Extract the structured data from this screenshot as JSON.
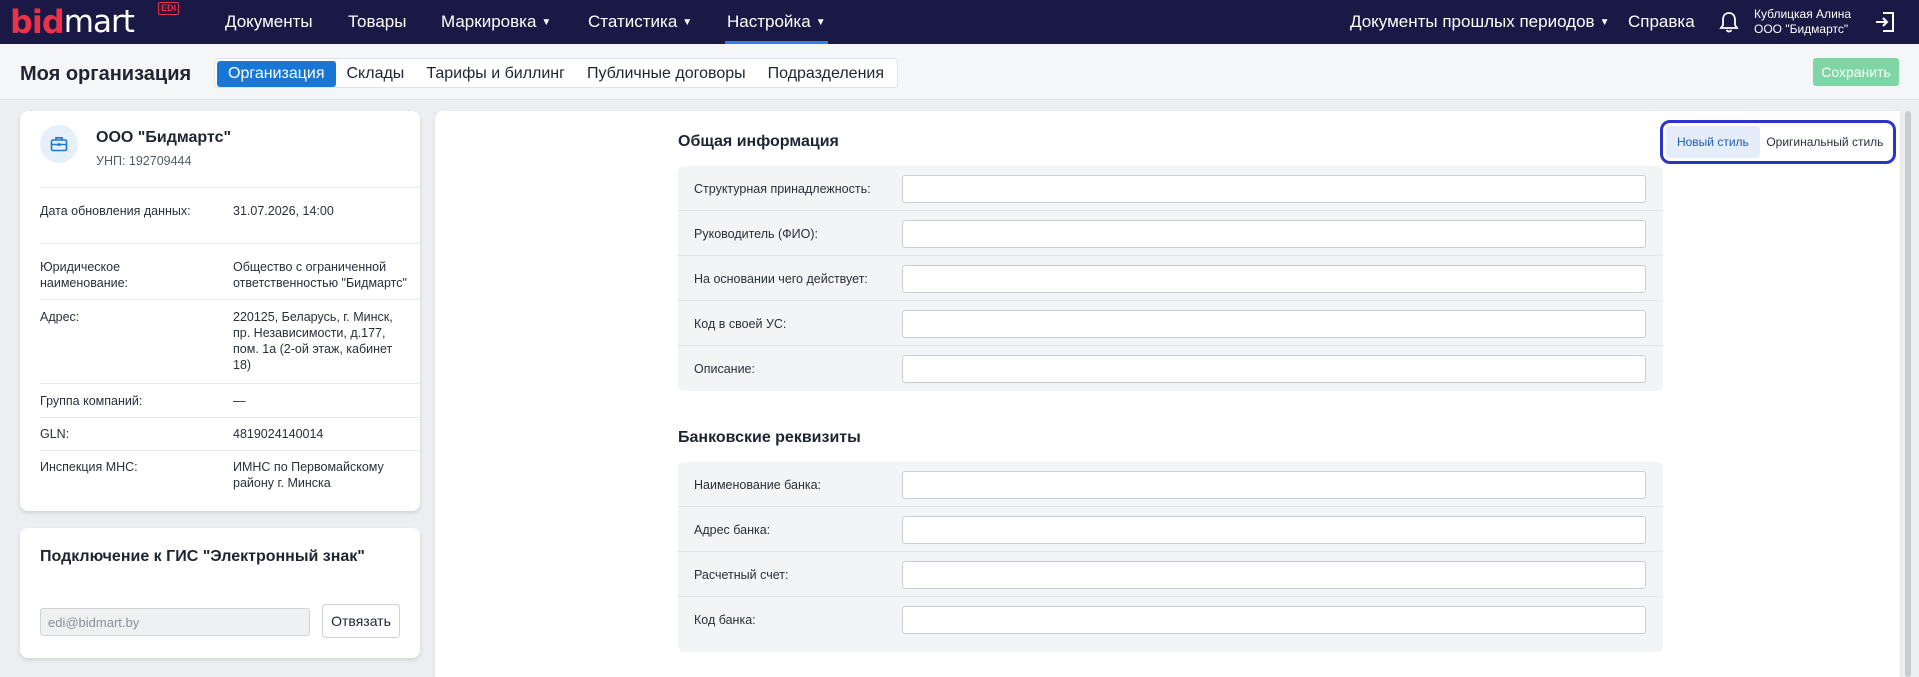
{
  "brand": {
    "bid": "bid",
    "mart": "mart",
    "edi": "EDI"
  },
  "nav": {
    "items": [
      {
        "label": "Документы",
        "chevron": false
      },
      {
        "label": "Товары",
        "chevron": false
      },
      {
        "label": "Маркировка",
        "chevron": true
      },
      {
        "label": "Статистика",
        "chevron": true
      },
      {
        "label": "Настройка",
        "chevron": true
      }
    ],
    "past_docs": "Документы прошлых периодов",
    "help": "Справка",
    "user_name": "Кублицкая Алина",
    "user_org": "ООО \"Бидмартс\""
  },
  "subheader": {
    "title": "Моя организация",
    "tabs": [
      "Организация",
      "Склады",
      "Тарифы и биллинг",
      "Публичные договоры",
      "Подразделения"
    ],
    "save": "Сохранить"
  },
  "org": {
    "name": "ООО \"Бидмартс\"",
    "unp": "УНП: 192709444",
    "rows": [
      {
        "label": "Дата обновления данных:",
        "value": "31.07.2026, 14:00"
      },
      {
        "label": "Юридическое наименование:",
        "value": "Общество с ограниченной ответственностью \"Бидмартс\""
      },
      {
        "label": "Адрес:",
        "value": "220125, Беларусь, г. Минск, пр. Независимости, д.177, пом. 1а (2-ой этаж, кабинет 18)"
      },
      {
        "label": "Группа компаний:",
        "value": "—"
      },
      {
        "label": "GLN:",
        "value": "4819024140014"
      },
      {
        "label": "Инспекция МНС:",
        "value": "ИМНС по Первомайскому району г. Минска"
      }
    ]
  },
  "gis": {
    "title": "Подключение к ГИС \"Электронный знак\"",
    "email_placeholder": "edi@bidmart.by",
    "unlink": "Отвязать"
  },
  "general": {
    "title": "Общая информация",
    "fields": [
      "Структурная принадлежность:",
      "Руководитель (ФИО):",
      "На основании чего действует:",
      "Код в своей УС:",
      "Описание:"
    ]
  },
  "bank": {
    "title": "Банковские реквизиты",
    "fields": [
      "Наименование банка:",
      "Адрес банка:",
      "Расчетный счет:",
      "Код банка:"
    ]
  },
  "style_toggle": {
    "new": "Новый стиль",
    "original": "Оригинальный стиль"
  },
  "colors": {
    "nav_bg": "#1a1845",
    "brand_red": "#e8334a",
    "accent": "#1877d6",
    "save": "#7fd6a4",
    "highlight": "#2b33c8"
  }
}
